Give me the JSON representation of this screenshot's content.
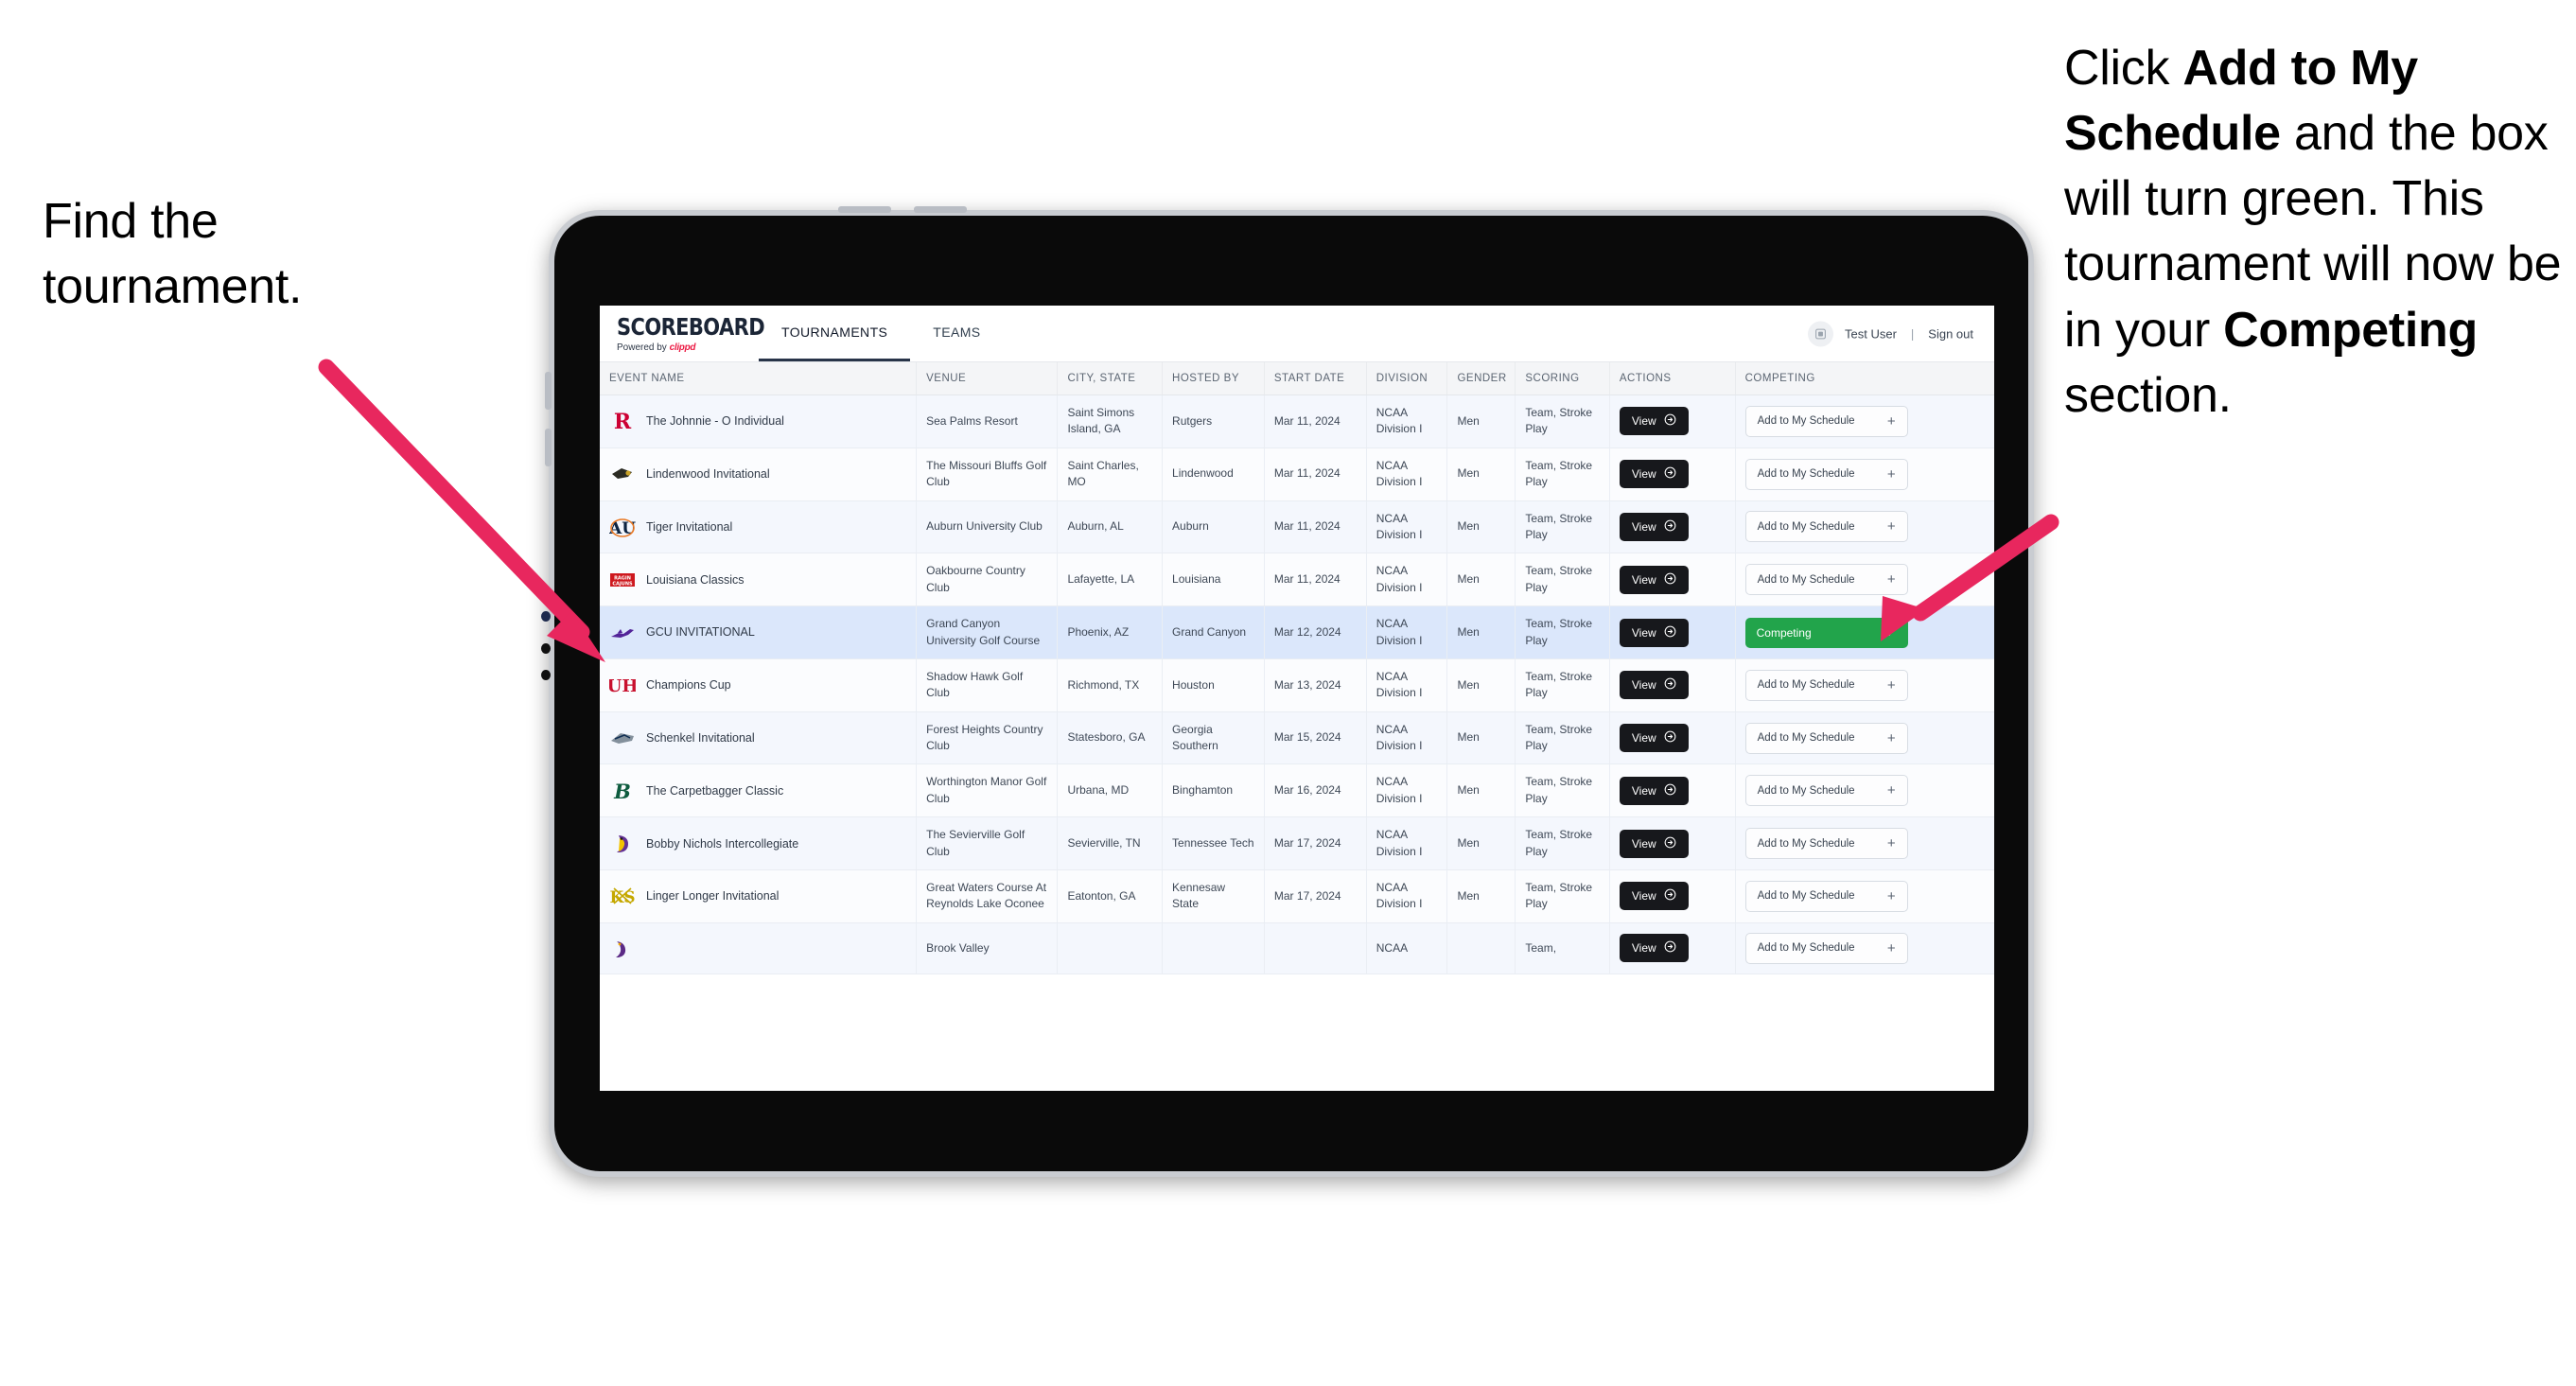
{
  "annotations": {
    "left": {
      "line1": "Find the",
      "line2": "tournament."
    },
    "right": {
      "seg1": "Click ",
      "bold1": "Add to My Schedule",
      "seg2": " and the box will turn green. This tournament will now be in your ",
      "bold2": "Competing",
      "seg3": " section."
    }
  },
  "app": {
    "brand": {
      "title": "SCOREBOARD",
      "powered_prefix": "Powered by ",
      "powered_name": "clippd"
    },
    "nav": [
      {
        "label": "TOURNAMENTS",
        "active": true
      },
      {
        "label": "TEAMS",
        "active": false
      }
    ],
    "user": {
      "name": "Test User",
      "separator": "|",
      "signout": "Sign out",
      "avatar_icon": "user-avatar-icon"
    }
  },
  "table": {
    "columns": [
      "EVENT NAME",
      "VENUE",
      "CITY, STATE",
      "HOSTED BY",
      "START DATE",
      "DIVISION",
      "GENDER",
      "SCORING",
      "ACTIONS",
      "COMPETING"
    ],
    "buttons": {
      "view": "View",
      "add": "Add to My Schedule",
      "competing": "Competing",
      "plus_icon": "plus-icon",
      "check_icon": "check-icon",
      "arrow_icon": "arrow-right-circle-icon"
    },
    "rows": [
      {
        "event": "The Johnnie - O Individual",
        "venue": "Sea Palms Resort",
        "city": "Saint Simons Island, GA",
        "hosted_by": "Rutgers",
        "start_date": "Mar 11, 2024",
        "division": "NCAA Division I",
        "gender": "Men",
        "scoring": "Team, Stroke Play",
        "competing": false,
        "logo": "rutgers-logo"
      },
      {
        "event": "Lindenwood Invitational",
        "venue": "The Missouri Bluffs Golf Club",
        "city": "Saint Charles, MO",
        "hosted_by": "Lindenwood",
        "start_date": "Mar 11, 2024",
        "division": "NCAA Division I",
        "gender": "Men",
        "scoring": "Team, Stroke Play",
        "competing": false,
        "logo": "lindenwood-logo"
      },
      {
        "event": "Tiger Invitational",
        "venue": "Auburn University Club",
        "city": "Auburn, AL",
        "hosted_by": "Auburn",
        "start_date": "Mar 11, 2024",
        "division": "NCAA Division I",
        "gender": "Men",
        "scoring": "Team, Stroke Play",
        "competing": false,
        "logo": "auburn-logo"
      },
      {
        "event": "Louisiana Classics",
        "venue": "Oakbourne Country Club",
        "city": "Lafayette, LA",
        "hosted_by": "Louisiana",
        "start_date": "Mar 11, 2024",
        "division": "NCAA Division I",
        "gender": "Men",
        "scoring": "Team, Stroke Play",
        "competing": false,
        "logo": "louisiana-logo"
      },
      {
        "event": "GCU INVITATIONAL",
        "venue": "Grand Canyon University Golf Course",
        "city": "Phoenix, AZ",
        "hosted_by": "Grand Canyon",
        "start_date": "Mar 12, 2024",
        "division": "NCAA Division I",
        "gender": "Men",
        "scoring": "Team, Stroke Play",
        "competing": true,
        "logo": "grand-canyon-logo"
      },
      {
        "event": "Champions Cup",
        "venue": "Shadow Hawk Golf Club",
        "city": "Richmond, TX",
        "hosted_by": "Houston",
        "start_date": "Mar 13, 2024",
        "division": "NCAA Division I",
        "gender": "Men",
        "scoring": "Team, Stroke Play",
        "competing": false,
        "logo": "houston-logo"
      },
      {
        "event": "Schenkel Invitational",
        "venue": "Forest Heights Country Club",
        "city": "Statesboro, GA",
        "hosted_by": "Georgia Southern",
        "start_date": "Mar 15, 2024",
        "division": "NCAA Division I",
        "gender": "Men",
        "scoring": "Team, Stroke Play",
        "competing": false,
        "logo": "georgia-southern-logo"
      },
      {
        "event": "The Carpetbagger Classic",
        "venue": "Worthington Manor Golf Club",
        "city": "Urbana, MD",
        "hosted_by": "Binghamton",
        "start_date": "Mar 16, 2024",
        "division": "NCAA Division I",
        "gender": "Men",
        "scoring": "Team, Stroke Play",
        "competing": false,
        "logo": "binghamton-logo"
      },
      {
        "event": "Bobby Nichols Intercollegiate",
        "venue": "The Sevierville Golf Club",
        "city": "Sevierville, TN",
        "hosted_by": "Tennessee Tech",
        "start_date": "Mar 17, 2024",
        "division": "NCAA Division I",
        "gender": "Men",
        "scoring": "Team, Stroke Play",
        "competing": false,
        "logo": "tennessee-tech-logo"
      },
      {
        "event": "Linger Longer Invitational",
        "venue": "Great Waters Course At Reynolds Lake Oconee",
        "city": "Eatonton, GA",
        "hosted_by": "Kennesaw State",
        "start_date": "Mar 17, 2024",
        "division": "NCAA Division I",
        "gender": "Men",
        "scoring": "Team, Stroke Play",
        "competing": false,
        "logo": "kennesaw-state-logo"
      },
      {
        "event": "",
        "venue": "Brook Valley",
        "city": "",
        "hosted_by": "",
        "start_date": "",
        "division": "NCAA",
        "gender": "",
        "scoring": "Team,",
        "competing": false,
        "logo": "partial-logo"
      }
    ]
  },
  "colors": {
    "accent_pink": "#e8275e",
    "competing_green": "#22a44b",
    "selected_row": "#dbe7fb",
    "brand_red": "#ec1c45"
  }
}
